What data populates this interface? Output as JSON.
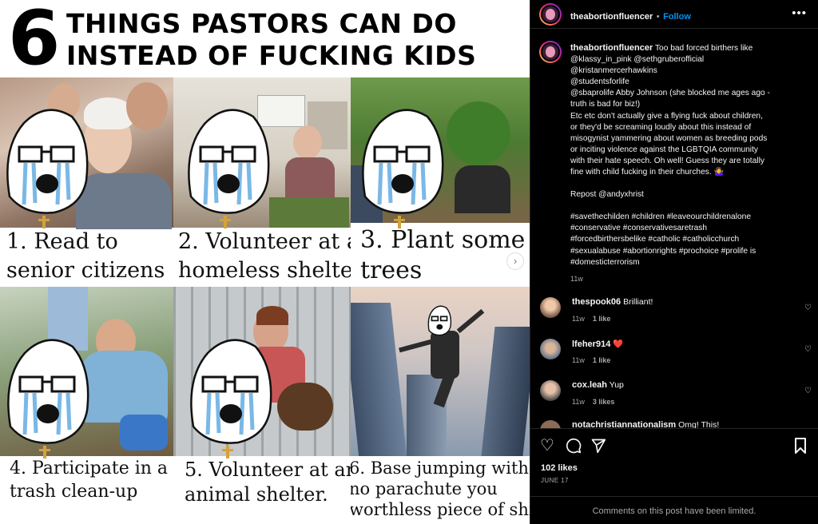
{
  "meme": {
    "number": "6",
    "title_line1": "THINGS PASTORS CAN DO",
    "title_line2": "INSTEAD OF FUCKING KIDS",
    "panels": [
      {
        "line1": "1. Read to",
        "line2": "senior citizens"
      },
      {
        "line1": "2. Volunteer at a",
        "line2": "homeless shelter"
      },
      {
        "line1": "3. Plant some",
        "line2": "trees"
      },
      {
        "line1": "4. Participate in a",
        "line2": "trash clean-up"
      },
      {
        "line1": "5. Volunteer at an",
        "line2": "animal shelter."
      },
      {
        "line1": "6. Base jumping with",
        "line2": "no parachute you",
        "line3": "worthless piece of shits"
      }
    ],
    "next_icon": "chevron-right-icon"
  },
  "post": {
    "author": "theabortionfluencer",
    "separator": "•",
    "follow_label": "Follow",
    "more_icon": "more-horizontal-icon",
    "caption_author": "theabortionfluencer",
    "caption_lines": [
      "Too bad forced birthers like",
      "@klassy_in_pink @sethgruberofficial",
      "@kristanmercerhawkins",
      "@studentsforlife",
      "@sbaprolife Abby Johnson (she blocked me ages ago -",
      "truth is bad for biz!)",
      "Etc etc don't actually give a flying fuck about children,",
      "or they'd be screaming loudly about this instead of",
      "misogynist yammering about women as breeding pods",
      "or inciting violence against the LGBTQIA community",
      "with their hate speech. Oh well! Guess they are totally",
      "fine with child fucking in their churches. 🤷‍♀️"
    ],
    "repost": "Repost @andyxhrist",
    "hashtag_lines": [
      "#savethechilden #children #leaveourchildrenalone",
      "#conservative #conservativesaretrash",
      "#forcedbirthersbelike #catholic #catholicchurch",
      "#sexualabuse #abortionrights #prochoice #prolife is",
      "#domesticterrorism"
    ],
    "caption_time": "11w"
  },
  "comments": [
    {
      "user": "thespook06",
      "text": "Brilliant!",
      "time": "11w",
      "likes": "1 like"
    },
    {
      "user": "lfeher914",
      "text": "❤️",
      "time": "11w",
      "likes": "1 like"
    },
    {
      "user": "cox.leah",
      "text": "Yup",
      "time": "11w",
      "likes": "3 likes"
    },
    {
      "user": "notachristiannationalism",
      "text": "Omg! This!"
    }
  ],
  "actions": {
    "like_icon": "heart-icon",
    "comment_icon": "comment-icon",
    "share_icon": "share-icon",
    "save_icon": "bookmark-icon",
    "likes": "102 likes",
    "date": "JUNE 17",
    "limited_note": "Comments on this post have been limited."
  },
  "colors": {
    "accent": "#0095f6",
    "background": "#000000",
    "secondary_text": "#a8a8a8",
    "heart_red": "#ff3040"
  }
}
